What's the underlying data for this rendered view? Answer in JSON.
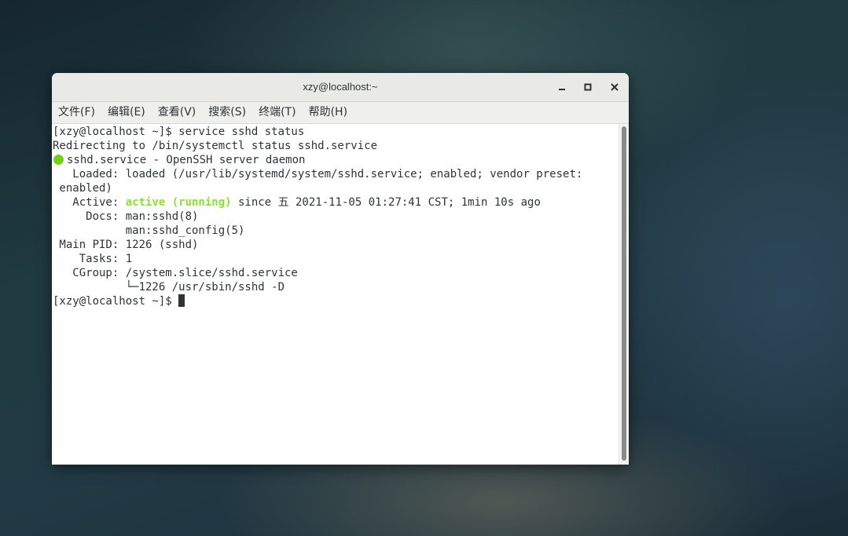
{
  "window": {
    "title": "xzy@localhost:~"
  },
  "menu": {
    "items": [
      "文件(F)",
      "编辑(E)",
      "查看(V)",
      "搜索(S)",
      "终端(T)",
      "帮助(H)"
    ]
  },
  "terminal": {
    "lines": {
      "l1": "[xzy@localhost ~]$ service sshd status",
      "l2": "Redirecting to /bin/systemctl status sshd.service",
      "l3": "sshd.service - OpenSSH server daemon",
      "l4": "   Loaded: loaded (/usr/lib/systemd/system/sshd.service; enabled; vendor preset:",
      "l5": " enabled)",
      "l6a": "   Active: ",
      "l6b": "active (running)",
      "l6c": " since 五 2021-11-05 01:27:41 CST; 1min 10s ago",
      "l7": "     Docs: man:sshd(8)",
      "l8": "           man:sshd_config(5)",
      "l9": " Main PID: 1226 (sshd)",
      "l10": "    Tasks: 1",
      "l11": "   CGroup: /system.slice/sshd.service",
      "l12": "           └─1226 /usr/sbin/sshd -D",
      "l13": "[xzy@localhost ~]$ "
    },
    "status_color": "#73d216",
    "active_color": "#8ae234"
  },
  "icons": {
    "minimize": "minimize-icon",
    "maximize": "maximize-icon",
    "close": "close-icon",
    "status": "status-dot-icon"
  }
}
